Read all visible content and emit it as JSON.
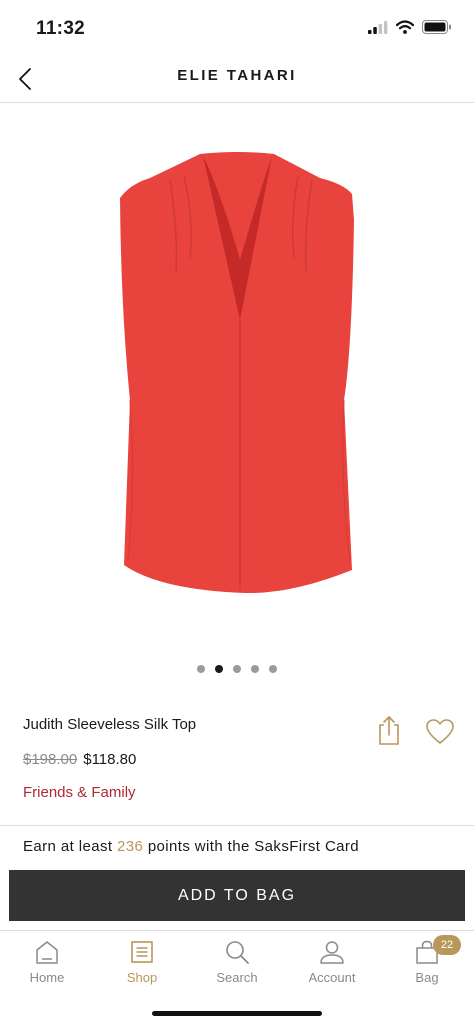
{
  "status_bar": {
    "time": "11:32",
    "icons": [
      "cellular-signal-icon",
      "wifi-icon",
      "battery-icon"
    ]
  },
  "nav": {
    "title": "ELIE TAHARI",
    "back_icon": "chevron-left-icon"
  },
  "product": {
    "image": "red sleeveless silk top",
    "name": "Judith Sleeveless Silk Top",
    "original_price": "$198.00",
    "sale_price": "$118.80",
    "promo": "Friends & Family",
    "image_count": 5,
    "active_image": 2
  },
  "points": {
    "prefix": "Earn at least",
    "value": "236",
    "suffix": "points with the SaksFirst Card"
  },
  "actions": {
    "add_to_bag": "ADD TO BAG"
  },
  "tabs": [
    {
      "label": "Home",
      "icon": "home-icon",
      "active": false
    },
    {
      "label": "Shop",
      "icon": "shop-list-icon",
      "active": true
    },
    {
      "label": "Search",
      "icon": "search-icon",
      "active": false
    },
    {
      "label": "Account",
      "icon": "account-icon",
      "active": false
    },
    {
      "label": "Bag",
      "icon": "bag-icon",
      "active": false,
      "badge": "22"
    }
  ],
  "colors": {
    "accent_gold": "#b8975a",
    "promo_red": "#b02a30",
    "button_dark": "#333333",
    "product_red": "#e8433d"
  }
}
